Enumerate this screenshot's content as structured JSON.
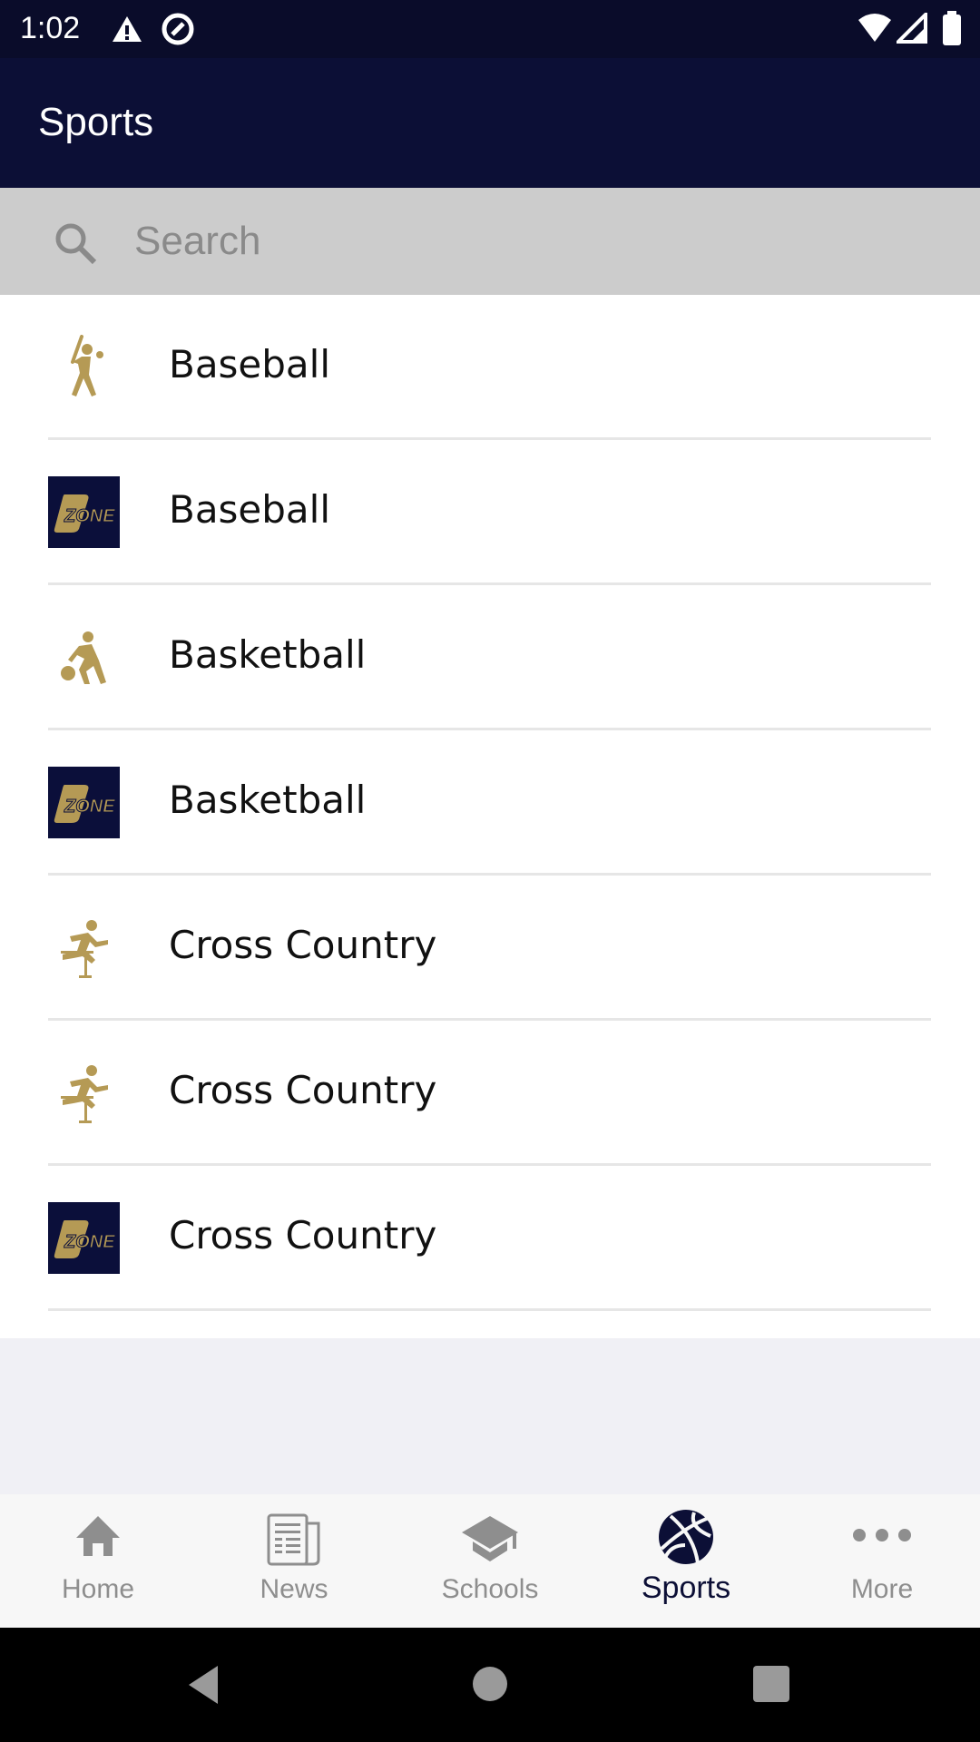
{
  "status_bar": {
    "time": "1:02",
    "icons": [
      "warning-icon",
      "at-sign-icon",
      "wifi-icon",
      "signal-icon",
      "battery-icon"
    ]
  },
  "app_bar": {
    "title": "Sports"
  },
  "search": {
    "placeholder": "Search",
    "value": ""
  },
  "list": [
    {
      "label": "Baseball",
      "icon": "baseball-player-icon"
    },
    {
      "label": "Baseball",
      "icon": "zone-logo"
    },
    {
      "label": "Basketball",
      "icon": "basketball-player-icon"
    },
    {
      "label": "Basketball",
      "icon": "zone-logo"
    },
    {
      "label": "Cross Country",
      "icon": "runner-hurdle-icon"
    },
    {
      "label": "Cross Country",
      "icon": "runner-hurdle-icon"
    },
    {
      "label": "Cross Country",
      "icon": "zone-logo"
    }
  ],
  "logo_text": "ZONE",
  "bottom_nav": {
    "tabs": [
      {
        "label": "Home"
      },
      {
        "label": "News"
      },
      {
        "label": "Schools"
      },
      {
        "label": "Sports",
        "active": true
      },
      {
        "label": "More"
      }
    ]
  },
  "colors": {
    "primary": "#0c0f36",
    "gold": "#b59a55",
    "inactive": "#8e8e8e"
  }
}
